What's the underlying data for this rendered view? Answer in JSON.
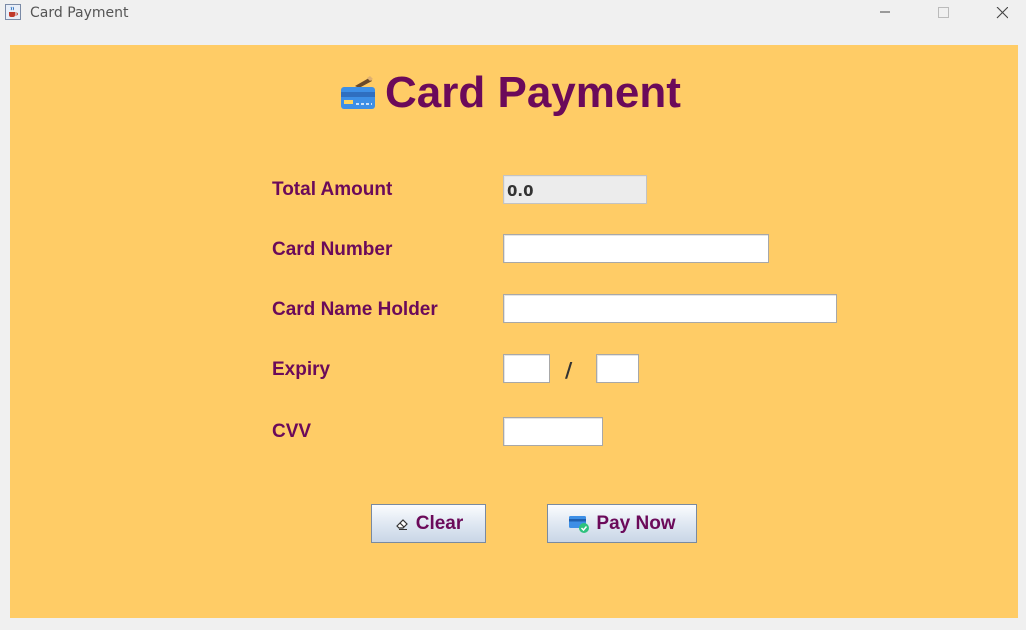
{
  "window": {
    "title": "Card Payment",
    "controls": [
      "minimize-icon",
      "maximize-icon",
      "close-icon"
    ]
  },
  "heading": {
    "icon": "credit-card-icon",
    "text": "Card Payment"
  },
  "form": {
    "total_amount": {
      "label": "Total Amount",
      "value": "0.0"
    },
    "card_number": {
      "label": "Card Number",
      "value": ""
    },
    "card_name_holder": {
      "label": "Card Name Holder",
      "value": ""
    },
    "expiry": {
      "label": "Expiry",
      "separator": "/",
      "month": "",
      "year": ""
    },
    "cvv": {
      "label": "CVV",
      "value": ""
    }
  },
  "buttons": {
    "clear": {
      "label": "Clear",
      "icon": "eraser-icon"
    },
    "pay_now": {
      "label": "Pay Now",
      "icon": "card-check-icon"
    }
  },
  "colors": {
    "panel_background": "#ffcc66",
    "label_text": "#6b0a5a",
    "window_background": "#f0f0f0"
  }
}
